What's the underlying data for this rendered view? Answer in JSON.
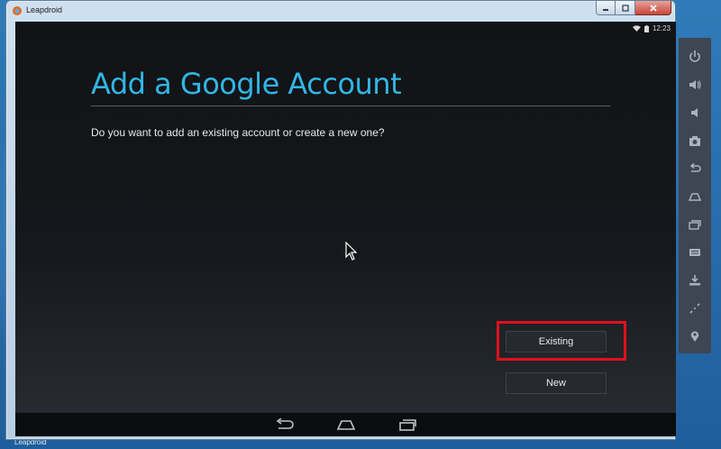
{
  "window": {
    "title": "Leapdroid"
  },
  "statusbar": {
    "time": "12:23"
  },
  "dialog": {
    "heading": "Add a Google Account",
    "question": "Do you want to add an existing account or create a new one?",
    "existing_label": "Existing",
    "new_label": "New"
  },
  "desktop": {
    "label": "Leapdroid"
  },
  "toolbar": {
    "icons": [
      "power-icon",
      "volume-up-icon",
      "volume-down-icon",
      "camera-icon",
      "back-icon",
      "home-icon",
      "recents-icon",
      "keyboard-icon",
      "download-icon",
      "rotate-icon",
      "location-icon"
    ]
  },
  "colors": {
    "accent": "#33b5e5",
    "highlight": "#e0101c",
    "toolbar": "#3d4652"
  }
}
